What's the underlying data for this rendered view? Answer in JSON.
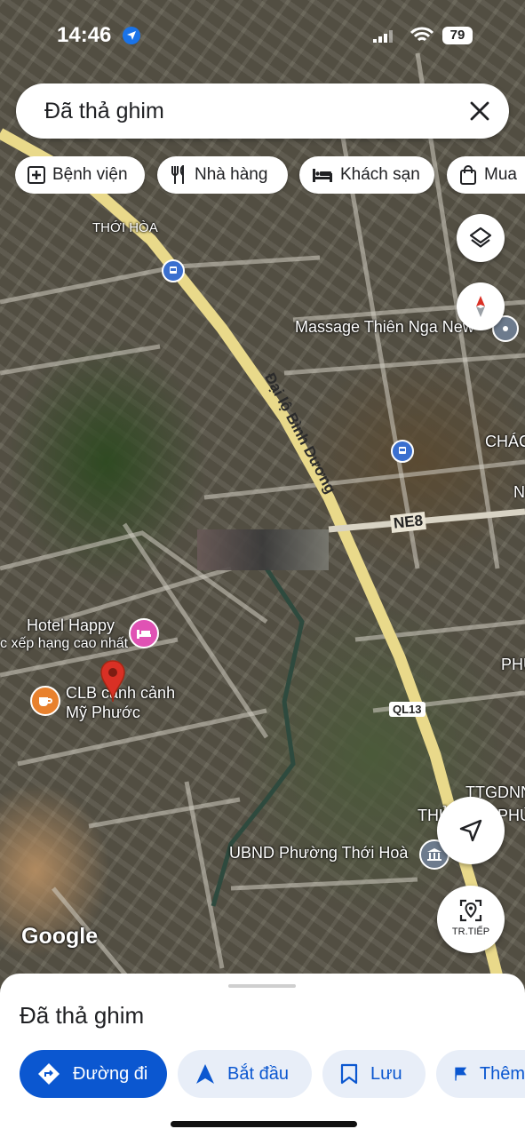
{
  "status": {
    "time": "14:46",
    "battery": "79"
  },
  "search": {
    "text": "Đã thả ghim"
  },
  "chips": [
    {
      "icon": "hospital-icon",
      "label": "Bệnh viện"
    },
    {
      "icon": "restaurant-icon",
      "label": "Nhà hàng"
    },
    {
      "icon": "hotel-icon",
      "label": "Khách sạn"
    },
    {
      "icon": "shopping-bag-icon",
      "label": "Mua"
    }
  ],
  "map": {
    "labels": {
      "thoi_hoa": "THỚI HÒA",
      "massage": "Massage Thiên Nga New",
      "chac": "CHÁC",
      "hotel": "Hotel Happy",
      "hotel_sub": "c xếp hạng cao nhất",
      "clb_line1": "CLB cảnh cảnh",
      "clb_line2": "Mỹ Phước",
      "ttgdn": "TTGDNN",
      "thu": "THỦ",
      "phu": "PHÚ",
      "ubnd": "UBND Phường Thới Hoà",
      "google": "Google",
      "n_edge": "N",
      "ph_edge": "PHU"
    },
    "roads": {
      "main": "Đại lộ Bình Dương",
      "ne8": "NE8",
      "ql13": "QL13"
    },
    "continue_label": "TR.TIẾP"
  },
  "sheet": {
    "title": "Đã thả ghim",
    "actions": [
      {
        "icon": "directions-icon",
        "label": "Đường đi"
      },
      {
        "icon": "navigation-arrow-icon",
        "label": "Bắt đầu"
      },
      {
        "icon": "bookmark-icon",
        "label": "Lưu"
      },
      {
        "icon": "flag-icon",
        "label": "Thêm"
      }
    ]
  },
  "colors": {
    "accent": "#0b57d0",
    "pin": "#d93025",
    "road": "#e9d98a"
  }
}
